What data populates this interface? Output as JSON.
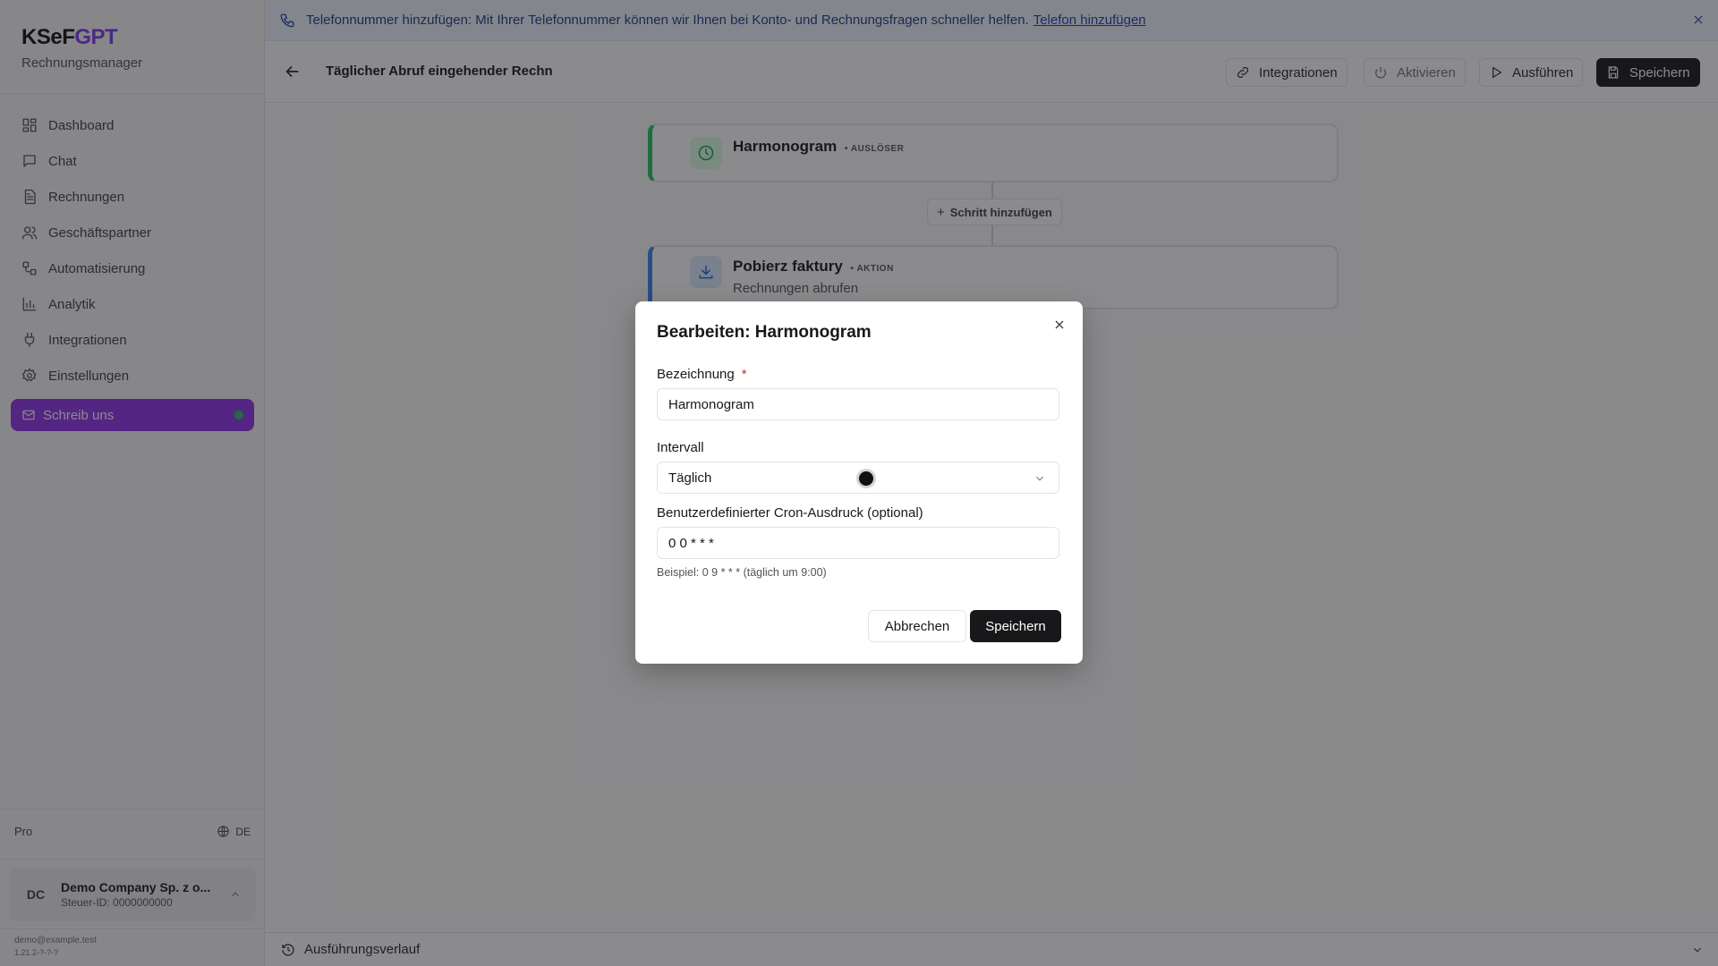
{
  "brand": {
    "name_primary": "KSeF",
    "name_accent": "GPT",
    "subtitle": "Rechnungsmanager"
  },
  "sidebar": {
    "items": [
      {
        "label": "Dashboard",
        "icon": "dashboard-icon"
      },
      {
        "label": "Chat",
        "icon": "chat-icon"
      },
      {
        "label": "Rechnungen",
        "icon": "invoice-icon"
      },
      {
        "label": "Geschäftspartner",
        "icon": "users-icon"
      },
      {
        "label": "Automatisierung",
        "icon": "workflow-icon"
      },
      {
        "label": "Analytik",
        "icon": "chart-icon"
      },
      {
        "label": "Integrationen",
        "icon": "plug-icon"
      },
      {
        "label": "Einstellungen",
        "icon": "gear-icon"
      }
    ],
    "cta": {
      "label": "Schreib uns",
      "icon": "mail-icon",
      "status_color": "#22c55e"
    },
    "plan": "Pro",
    "language": "DE",
    "company": {
      "initials": "DC",
      "name": "Demo Company Sp. z o...",
      "tax_id": "Steuer-ID: 0000000000"
    },
    "footer_email": "demo@example.test",
    "footer_version": "1.21.2-?-?-?"
  },
  "banner": {
    "text": "Telefonnummer hinzufügen: Mit Ihrer Telefonnummer können wir Ihnen bei Konto- und Rechnungsfragen schneller helfen.",
    "link": "Telefon hinzufügen"
  },
  "topbar": {
    "title": "Täglicher Abruf eingehender Rechnu",
    "buttons": {
      "integrations": "Integrationen",
      "activate": "Aktivieren",
      "run": "Ausführen",
      "save": "Speichern"
    }
  },
  "workflow": {
    "trigger": {
      "title": "Harmonogram",
      "tag": "• AUSLÖSER",
      "accent": "#22c55e"
    },
    "add_step": "Schritt hinzufügen",
    "action": {
      "title": "Pobierz faktury",
      "tag": "• AKTION",
      "subtitle": "Rechnungen abrufen",
      "accent": "#3b82f6"
    }
  },
  "history": {
    "label": "Ausführungsverlauf"
  },
  "modal": {
    "title": "Bearbeiten: Harmonogram",
    "name_label": "Bezeichnung",
    "required_mark": "*",
    "name_value": "Harmonogram",
    "interval_label": "Intervall",
    "interval_value": "Täglich",
    "cron_label": "Benutzerdefinierter Cron-Ausdruck (optional)",
    "cron_value": "0 0 * * *",
    "cron_hint": "Beispiel: 0 9 * * * (täglich um 9:00)",
    "cancel": "Abbrechen",
    "save": "Speichern"
  }
}
